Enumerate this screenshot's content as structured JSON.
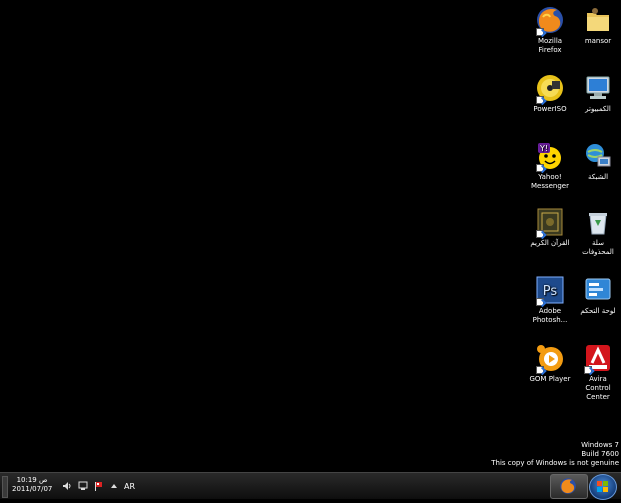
{
  "desktop": {
    "icons": [
      {
        "label": "Mozilla Firefox",
        "icon": "firefox-icon"
      },
      {
        "label": "mansor",
        "icon": "user-folder-icon"
      },
      {
        "label": "PowerISO",
        "icon": "poweriso-icon"
      },
      {
        "label": "الكمبيوتر",
        "icon": "computer-icon"
      },
      {
        "label": "Yahoo! Messenger",
        "icon": "yahoo-messenger-icon"
      },
      {
        "label": "الشبكة",
        "icon": "network-icon"
      },
      {
        "label": "القرآن الكريم",
        "icon": "quran-icon"
      },
      {
        "label": "سلة المحذوفات",
        "icon": "recycle-bin-icon"
      },
      {
        "label": "Adobe Photosh...",
        "icon": "photoshop-icon"
      },
      {
        "label": "لوحة التحكم",
        "icon": "control-panel-icon"
      },
      {
        "label": "GOM Player",
        "icon": "gom-player-icon"
      },
      {
        "label": "Avira Control Center",
        "icon": "avira-icon"
      }
    ],
    "watermark": {
      "line1": "Windows 7",
      "line2": "Build 7600",
      "line3": "This copy of Windows is not genuine"
    }
  },
  "taskbar": {
    "clock_time": "10:19 ص",
    "clock_date": "2011/07/07",
    "language": "AR",
    "tray_icons": [
      "volume-icon",
      "network-tray-icon",
      "action-center-flag-icon",
      "show-hidden-icons-arrow"
    ],
    "pinned": [
      "firefox-taskbar-icon"
    ],
    "start_button": "windows-start-orb"
  }
}
